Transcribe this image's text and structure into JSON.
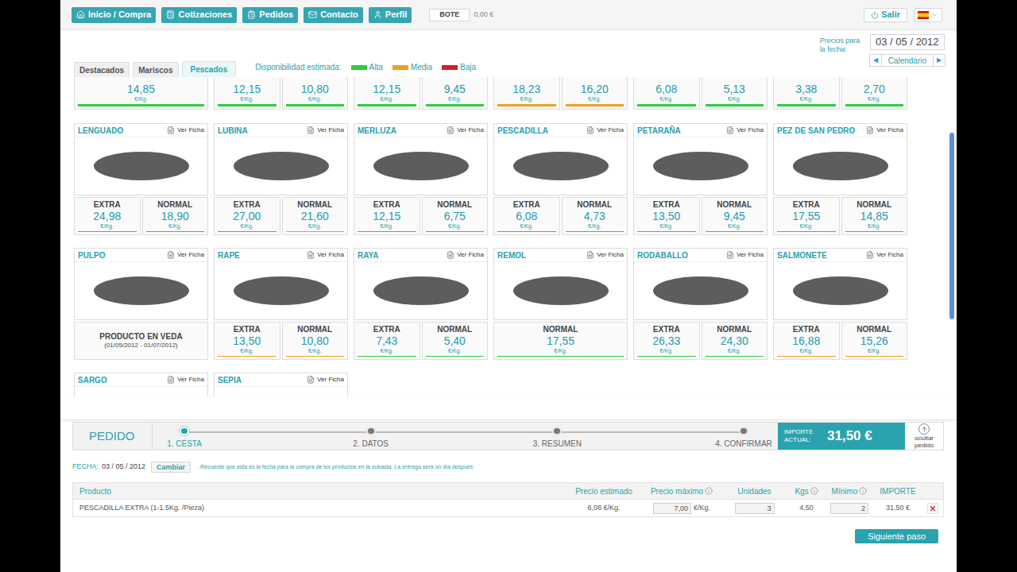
{
  "nav": [
    {
      "label": "Inicio / Compra"
    },
    {
      "label": "Cotizaciones"
    },
    {
      "label": "Pedidos"
    },
    {
      "label": "Contacto"
    },
    {
      "label": "Perfil"
    }
  ],
  "bote": {
    "label": "BOTE",
    "value": "0,00 €"
  },
  "logout": "Salir",
  "tabs": [
    {
      "label": "Destacados",
      "selected": false
    },
    {
      "label": "Mariscos",
      "selected": false
    },
    {
      "label": "Pescados",
      "selected": true
    }
  ],
  "availability": {
    "label": "Disponibilidad estimada:",
    "levels": [
      {
        "label": "Alta",
        "color": "#2ecc40"
      },
      {
        "label": "Media",
        "color": "#f0a020"
      },
      {
        "label": "Baja",
        "color": "#d0202a"
      }
    ]
  },
  "price_date": {
    "label": "Precios para la fecha:",
    "date": "03 / 05 / 2012",
    "calendar": "Calendario",
    "prev": "◀",
    "next": "▶"
  },
  "partial_row": [
    [
      {
        "price": "14,85",
        "unit": "€/Kg.",
        "color": "#2ecc40"
      }
    ],
    [
      {
        "price": "12,15",
        "unit": "€/Kg.",
        "color": "#2ecc40"
      },
      {
        "price": "10,80",
        "unit": "€/Kg.",
        "color": "#2ecc40"
      }
    ],
    [
      {
        "price": "12,15",
        "unit": "€/Kg.",
        "color": "#2ecc40"
      },
      {
        "price": "9,45",
        "unit": "€/Kg.",
        "color": "#2ecc40"
      }
    ],
    [
      {
        "price": "18,23",
        "unit": "€/Kg.",
        "color": "#f0a020"
      },
      {
        "price": "16,20",
        "unit": "€/Kg.",
        "color": "#f0a020"
      }
    ],
    [
      {
        "price": "6,08",
        "unit": "€/Kg.",
        "color": "#2ecc40"
      },
      {
        "price": "5,13",
        "unit": "€/Kg.",
        "color": "#2ecc40"
      }
    ],
    [
      {
        "price": "3,38",
        "unit": "€/Kg.",
        "color": "#2ecc40"
      },
      {
        "price": "2,70",
        "unit": "€/Kg.",
        "color": "#2ecc40"
      }
    ]
  ],
  "products": [
    {
      "name": "LENGUADO",
      "action": "Ver Ficha",
      "kind": "prices",
      "prices": [
        {
          "label": "EXTRA",
          "price": "24,98",
          "unit": "€/Kg.",
          "color": "#2ecc40"
        },
        {
          "label": "NORMAL",
          "price": "18,90",
          "unit": "€/Kg.",
          "color": "#2ecc40"
        }
      ]
    },
    {
      "name": "LUBINA",
      "action": "Ver Ficha",
      "kind": "prices",
      "prices": [
        {
          "label": "EXTRA",
          "price": "27,00",
          "unit": "€/Kg.",
          "color": "#2ecc40"
        },
        {
          "label": "NORMAL",
          "price": "21,60",
          "unit": "€/Kg.",
          "color": "#f0a020"
        }
      ]
    },
    {
      "name": "MERLUZA",
      "action": "Ver Ficha",
      "kind": "prices",
      "prices": [
        {
          "label": "EXTRA",
          "price": "12,15",
          "unit": "€/Kg.",
          "color": "#2ecc40"
        },
        {
          "label": "NORMAL",
          "price": "6,75",
          "unit": "€/Kg.",
          "color": "#2ecc40"
        }
      ]
    },
    {
      "name": "PESCADILLA",
      "action": "Ver Ficha",
      "kind": "prices",
      "prices": [
        {
          "label": "EXTRA",
          "price": "6,08",
          "unit": "€/Kg.",
          "color": "#2ecc40"
        },
        {
          "label": "NORMAL",
          "price": "4,73",
          "unit": "€/Kg.",
          "color": "#2ecc40"
        }
      ]
    },
    {
      "name": "PETARAÑA",
      "action": "Ver Ficha",
      "kind": "prices",
      "prices": [
        {
          "label": "EXTRA",
          "price": "13,50",
          "unit": "€/Kg.",
          "color": "#2ecc40"
        },
        {
          "label": "NORMAL",
          "price": "9,45",
          "unit": "€/Kg.",
          "color": "#2ecc40"
        }
      ]
    },
    {
      "name": "PEZ DE SAN PEDRO",
      "action": "Ver Ficha",
      "kind": "prices",
      "prices": [
        {
          "label": "EXTRA",
          "price": "17,55",
          "unit": "€/Kg.",
          "color": "#2ecc40"
        },
        {
          "label": "NORMAL",
          "price": "14,85",
          "unit": "€/Kg.",
          "color": "#2ecc40"
        }
      ]
    },
    {
      "name": "PULPO",
      "action": "Ver Ficha",
      "kind": "veda",
      "veda": {
        "title": "PRODUCTO EN VEDA",
        "dates": "(01/05/2012 - 01/07/2012)"
      }
    },
    {
      "name": "RAPE",
      "action": "Ver Ficha",
      "kind": "prices",
      "prices": [
        {
          "label": "EXTRA",
          "price": "13,50",
          "unit": "€/Kg.",
          "color": "#f0a020"
        },
        {
          "label": "NORMAL",
          "price": "10,80",
          "unit": "€/Kg.",
          "color": "#f0a020"
        }
      ]
    },
    {
      "name": "RAYA",
      "action": "Ver Ficha",
      "kind": "prices",
      "prices": [
        {
          "label": "EXTRA",
          "price": "7,43",
          "unit": "€/Kg.",
          "color": "#2ecc40"
        },
        {
          "label": "NORMAL",
          "price": "5,40",
          "unit": "€/Kg.",
          "color": "#2ecc40"
        }
      ]
    },
    {
      "name": "REMOL",
      "action": "Ver Ficha",
      "kind": "prices",
      "prices": [
        {
          "label": "NORMAL",
          "price": "17,55",
          "unit": "€/Kg.",
          "color": "#2ecc40"
        }
      ]
    },
    {
      "name": "RODABALLO",
      "action": "Ver Ficha",
      "kind": "prices",
      "prices": [
        {
          "label": "EXTRA",
          "price": "26,33",
          "unit": "€/Kg.",
          "color": "#2ecc40"
        },
        {
          "label": "NORMAL",
          "price": "24,30",
          "unit": "€/Kg.",
          "color": "#2ecc40"
        }
      ]
    },
    {
      "name": "SALMONETE",
      "action": "Ver Ficha",
      "kind": "prices",
      "prices": [
        {
          "label": "EXTRA",
          "price": "16,88",
          "unit": "€/Kg.",
          "color": "#f0a020"
        },
        {
          "label": "NORMAL",
          "price": "15,26",
          "unit": "€/Kg.",
          "color": "#f0a020"
        }
      ]
    },
    {
      "name": "SARGO",
      "action": "Ver Ficha",
      "kind": "partial"
    },
    {
      "name": "SEPIA",
      "action": "Ver Ficha",
      "kind": "partial"
    }
  ],
  "order": {
    "title": "PEDIDO",
    "steps": [
      {
        "label": "1. CESTA",
        "selected": true
      },
      {
        "label": "2. DATOS",
        "selected": false
      },
      {
        "label": "3. RESUMEN",
        "selected": false
      },
      {
        "label": "4. CONFIRMAR",
        "selected": false
      }
    ],
    "total_label": "IMPORTE ACTUAL:",
    "total": "31,50 €",
    "hide": "ocultar pedido",
    "date_label": "FECHA:",
    "date": "03 / 05 / 2012",
    "change": "Cambiar",
    "note": ". Recuerde que esta es la fecha para la compra de los productos en la subasta. La entrega será un día despues",
    "columns": [
      {
        "label": "Producto",
        "info": false
      },
      {
        "label": "Precio estimado",
        "info": false
      },
      {
        "label": "Precio máximo",
        "info": true
      },
      {
        "label": "Unidades",
        "info": false
      },
      {
        "label": "Kgs",
        "info": true
      },
      {
        "label": "Mínimo",
        "info": true
      },
      {
        "label": "IMPORTE",
        "info": false
      }
    ],
    "rows": [
      {
        "product": "PESCADILLA EXTRA (1-1.5Kg. /Pieza)",
        "estimated": "6,08 €/Kg.",
        "max_price": "7,00",
        "max_unit": "€/Kg.",
        "units": "3",
        "kgs": "4,50",
        "minimum": "2",
        "amount": "31,50 €"
      }
    ],
    "next": "Siguiente paso"
  }
}
